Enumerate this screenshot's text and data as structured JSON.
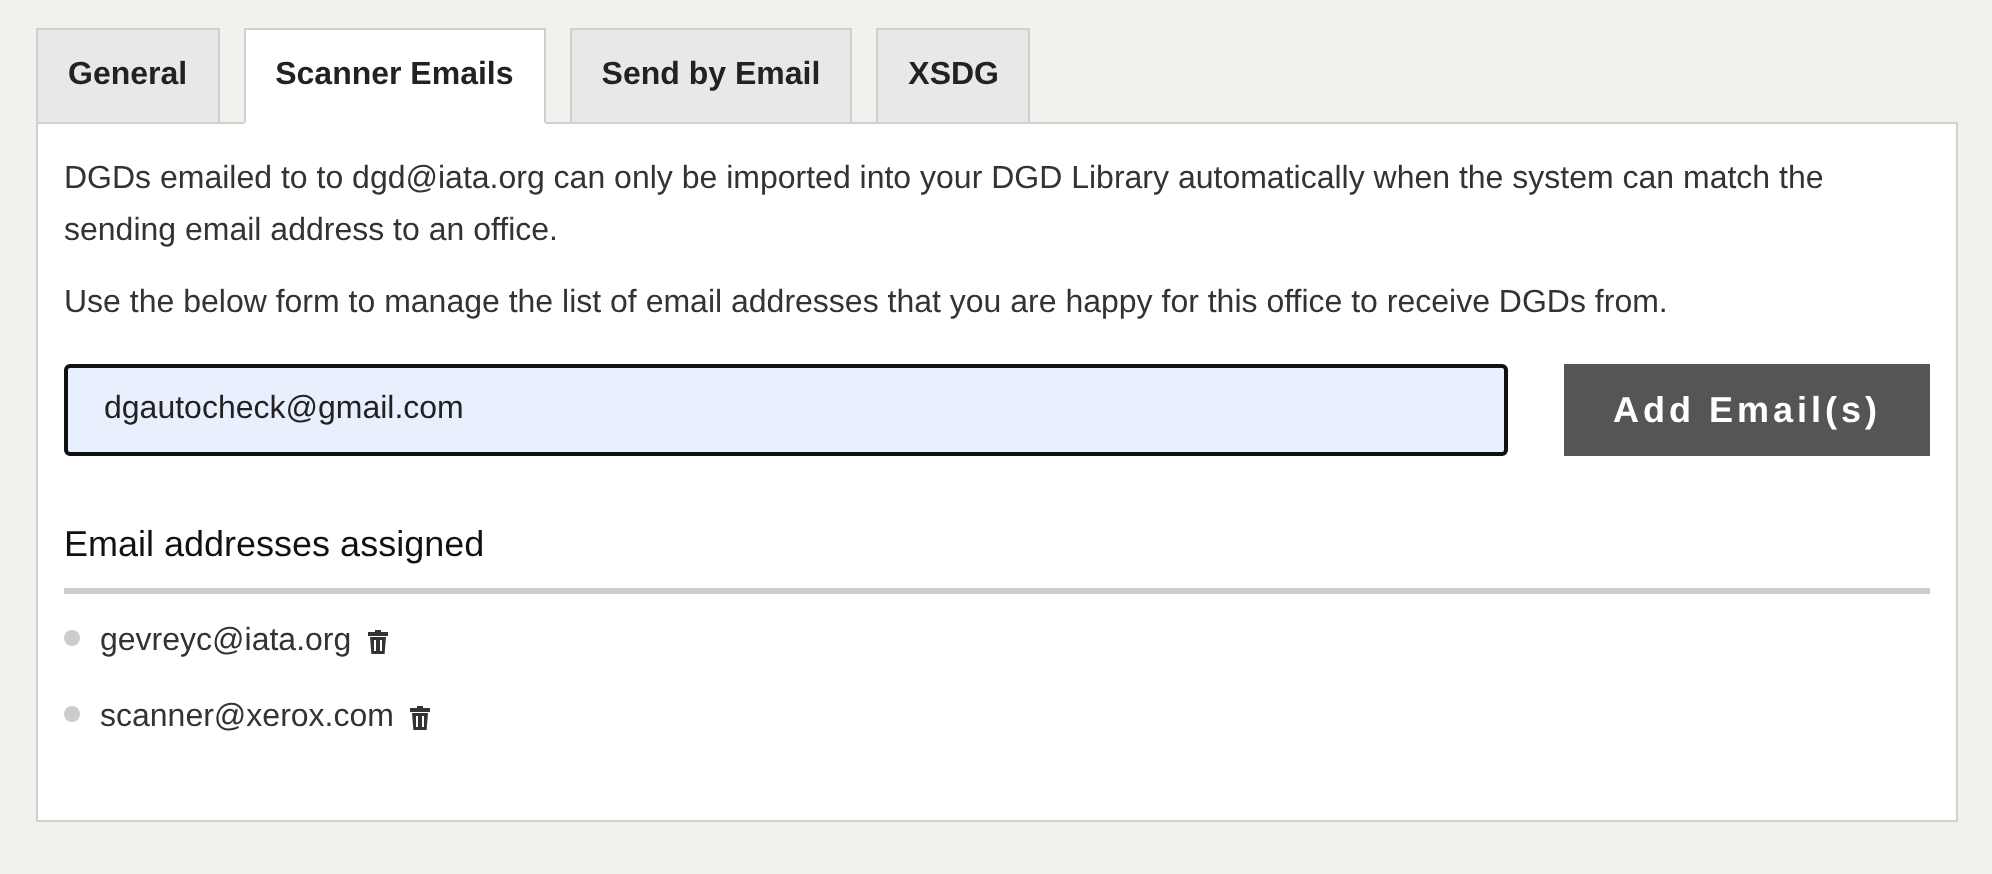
{
  "tabs": [
    {
      "label": "General",
      "selected": false
    },
    {
      "label": "Scanner Emails",
      "selected": true
    },
    {
      "label": "Send by Email",
      "selected": false
    },
    {
      "label": "XSDG",
      "selected": false
    }
  ],
  "intro": "DGDs emailed to to dgd@iata.org can only be imported into your DGD Library automatically when the system can match the sending email address to an office.",
  "instructions": "Use the below form to manage the list of email addresses that you are happy for this office to receive DGDs from.",
  "email_field": {
    "value": "dgautocheck@gmail.com"
  },
  "add_button": "Add Email(s)",
  "assigned": {
    "heading": "Email addresses assigned",
    "emails": [
      "gevreyc@iata.org",
      "scanner@xerox.com"
    ]
  }
}
